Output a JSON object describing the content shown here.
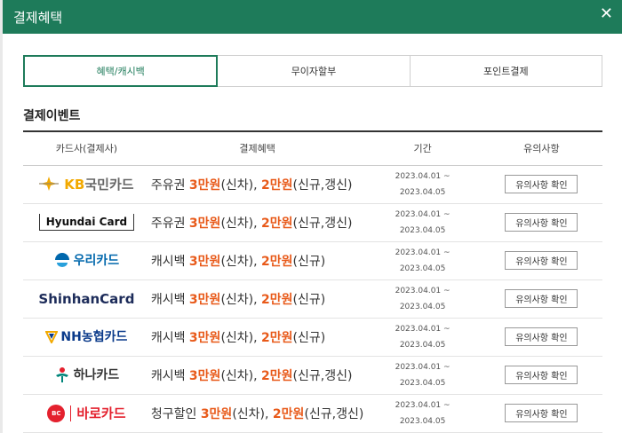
{
  "header": {
    "title": "결제혜택",
    "close_label": "✕"
  },
  "tabs": [
    {
      "label": "혜택/캐시백"
    },
    {
      "label": "무이자할부"
    },
    {
      "label": "포인트결제"
    }
  ],
  "section_title": "결제이벤트",
  "table": {
    "headers": [
      "카드사(결제사)",
      "결제혜택",
      "기간",
      "유의사항"
    ],
    "rows": [
      {
        "card": "KB국민카드",
        "logo_parts": [
          "KB",
          "국민카드"
        ],
        "benefit": [
          "주유권 ",
          "3만원",
          "(신차), ",
          "2만원",
          "(신규,갱신)"
        ],
        "period_start": "2023.04.01 ~",
        "period_end": "2023.04.05",
        "button": "유의사항 확인"
      },
      {
        "card": "Hyundai Card",
        "benefit": [
          "주유권 ",
          "3만원",
          "(신차), ",
          "2만원",
          "(신규,갱신)"
        ],
        "period_start": "2023.04.01 ~",
        "period_end": "2023.04.05",
        "button": "유의사항 확인"
      },
      {
        "card": "우리카드",
        "benefit": [
          "캐시백 ",
          "3만원",
          "(신차), ",
          "2만원",
          "(신규)"
        ],
        "period_start": "2023.04.01 ~",
        "period_end": "2023.04.05",
        "button": "유의사항 확인"
      },
      {
        "card": "ShinhanCard",
        "benefit": [
          "캐시백 ",
          "3만원",
          "(신차), ",
          "2만원",
          "(신규)"
        ],
        "period_start": "2023.04.01 ~",
        "period_end": "2023.04.05",
        "button": "유의사항 확인"
      },
      {
        "card": "NH농협카드",
        "logo_parts": [
          "NH",
          "농협카드"
        ],
        "benefit": [
          "캐시백 ",
          "3만원",
          "(신차), ",
          "2만원",
          "(신규)"
        ],
        "period_start": "2023.04.01 ~",
        "period_end": "2023.04.05",
        "button": "유의사항 확인"
      },
      {
        "card": "하나카드",
        "benefit": [
          "캐시백 ",
          "3만원",
          "(신차), ",
          "2만원",
          "(신규,갱신)"
        ],
        "period_start": "2023.04.01 ~",
        "period_end": "2023.04.05",
        "button": "유의사항 확인"
      },
      {
        "card": "비씨카드",
        "logo_parts": [
          "BC",
          "바로카드"
        ],
        "benefit": [
          "청구할인 ",
          "3만원",
          "(신차), ",
          "2만원",
          "(신규,갱신)"
        ],
        "period_start": "2023.04.01 ~",
        "period_end": "2023.04.05",
        "button": "유의사항 확인"
      }
    ]
  },
  "colors": {
    "header": "#1e7b5a",
    "highlight": "#e85a1a",
    "kb": "#f2a900",
    "woori": "#0067ac",
    "bc": "#e4212e"
  }
}
